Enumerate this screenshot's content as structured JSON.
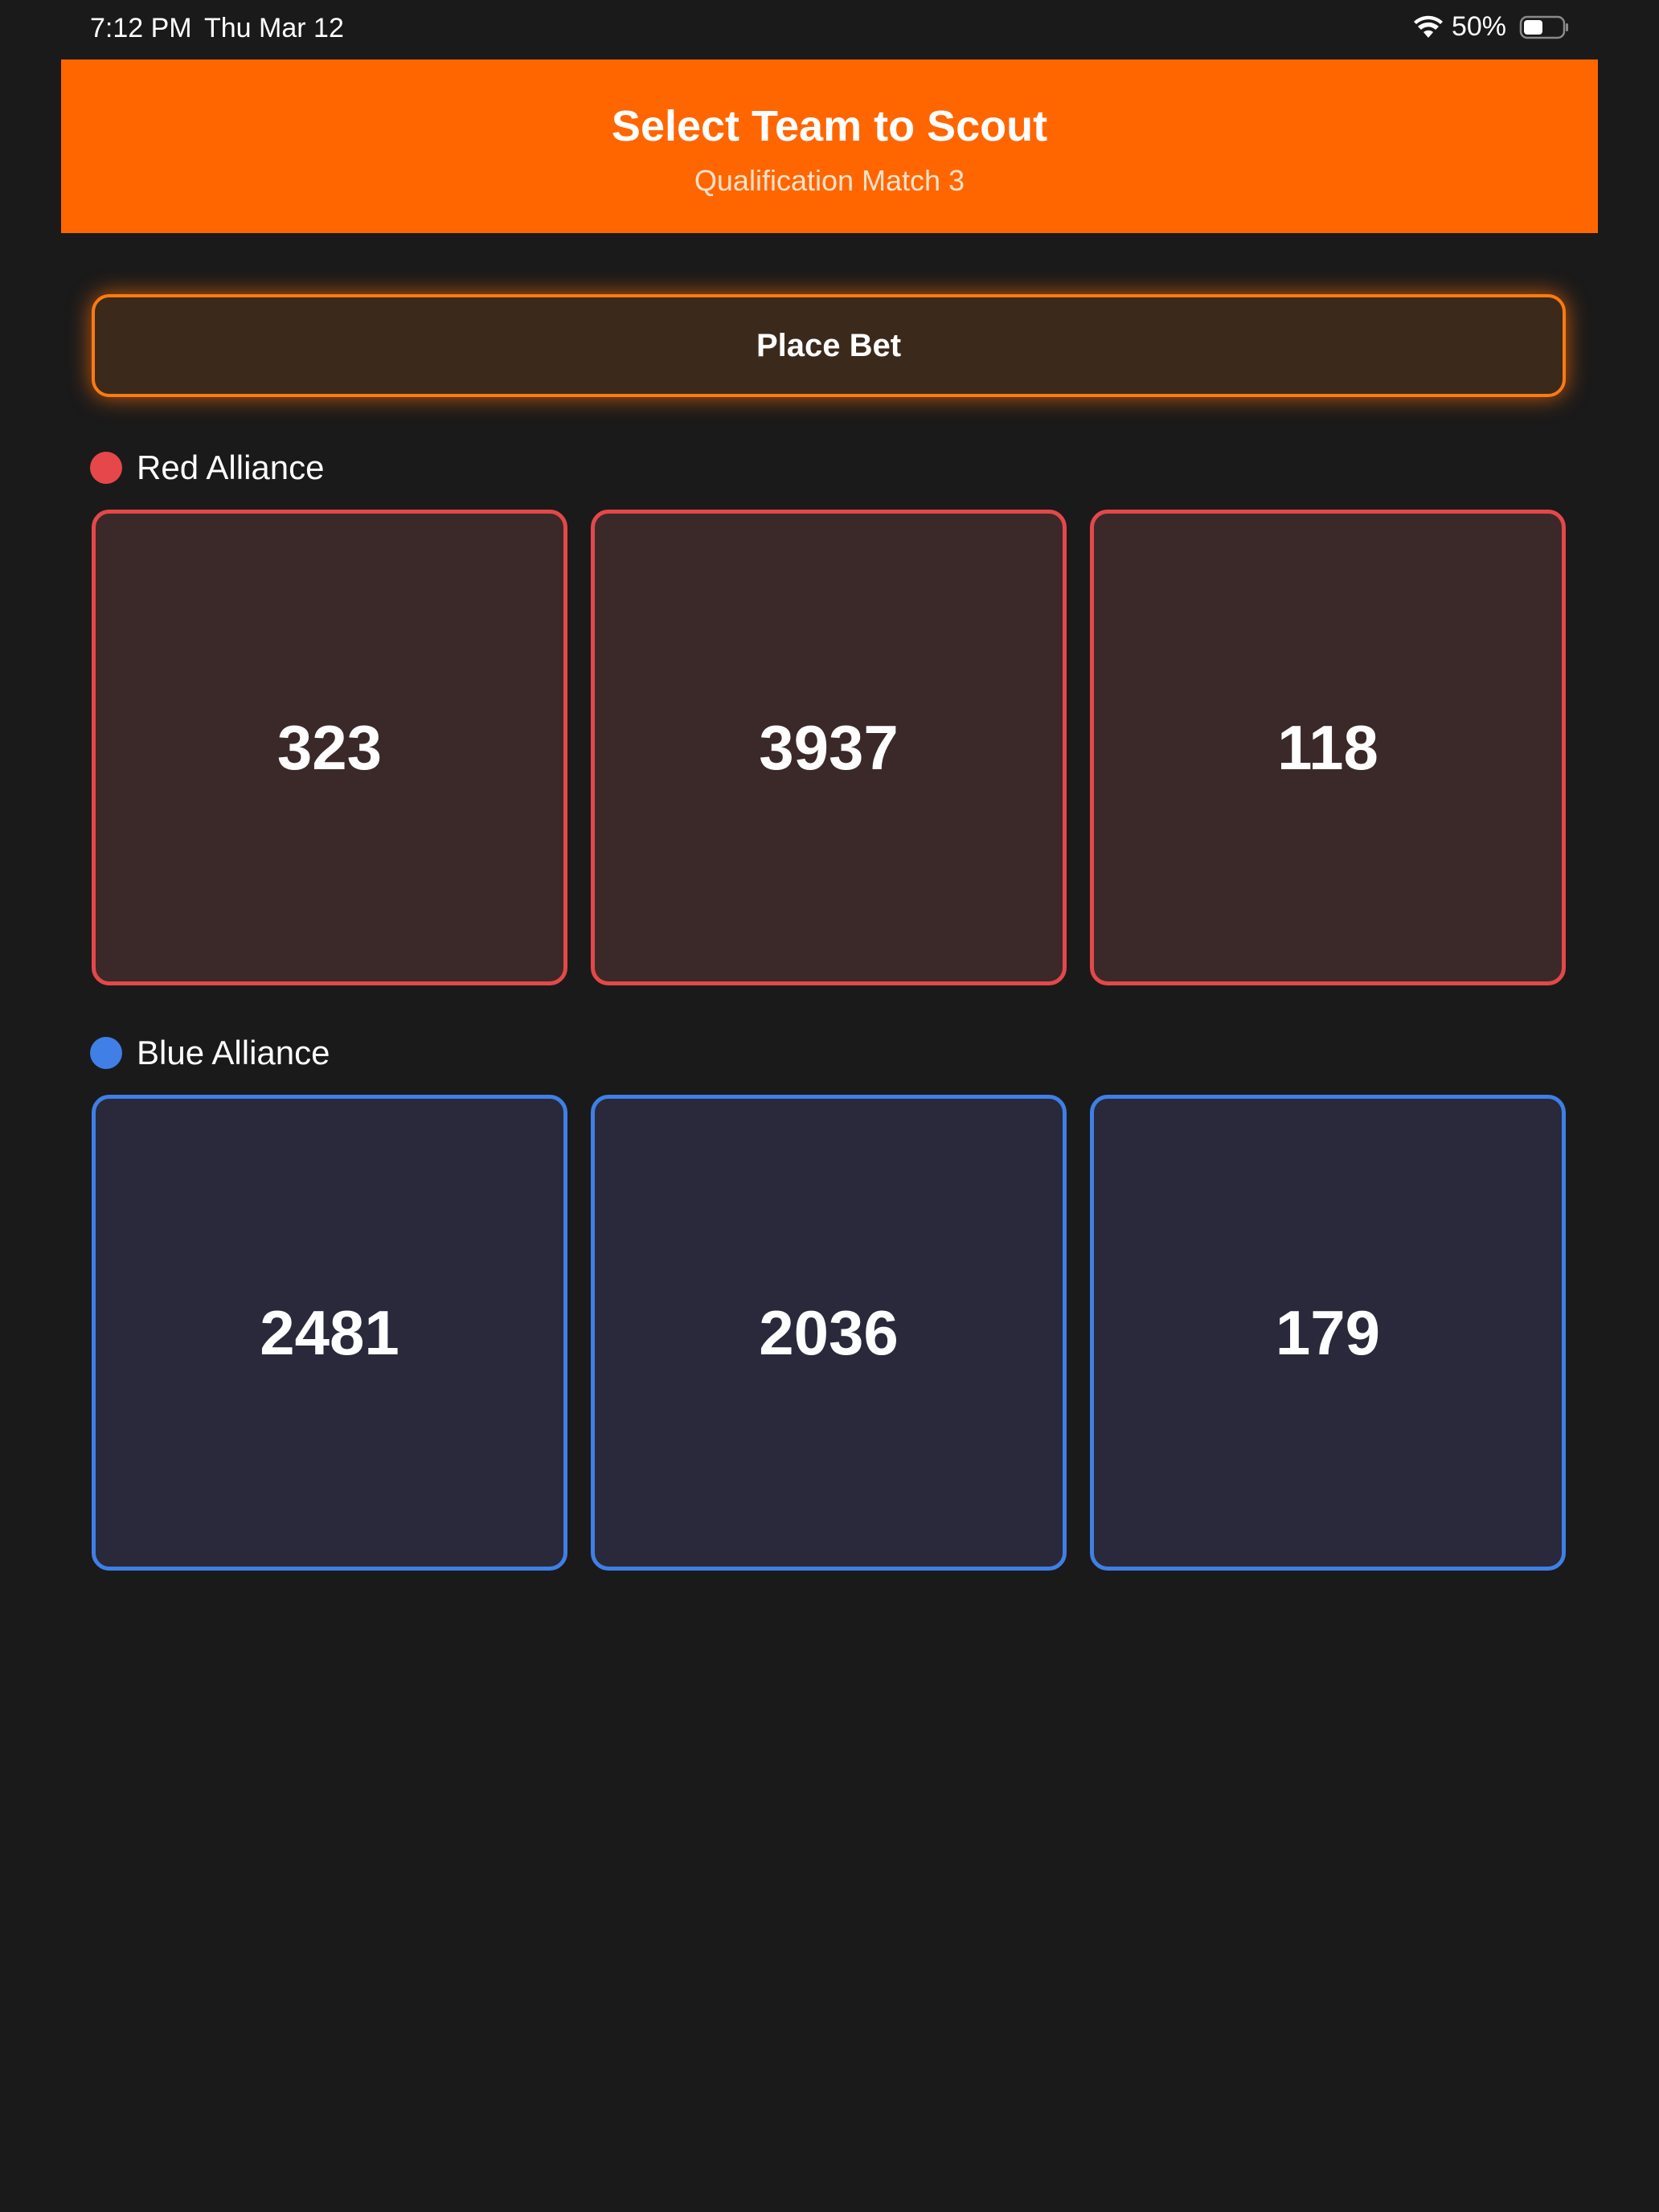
{
  "status_bar": {
    "time": "7:12 PM",
    "date": "Thu Mar 12",
    "battery_percent": "50%",
    "battery_level": 0.5,
    "wifi_icon": "wifi-icon",
    "battery_icon": "battery-icon"
  },
  "header": {
    "title": "Select Team to Scout",
    "subtitle": "Qualification Match 3",
    "background_color": "#ff6600"
  },
  "place_bet": {
    "label": "Place Bet",
    "accent_color": "#ff7a10"
  },
  "red_alliance": {
    "label": "Red Alliance",
    "color": "#e5474a",
    "teams": [
      "323",
      "3937",
      "118"
    ]
  },
  "blue_alliance": {
    "label": "Blue Alliance",
    "color": "#3f7fe6",
    "teams": [
      "2481",
      "2036",
      "179"
    ]
  }
}
